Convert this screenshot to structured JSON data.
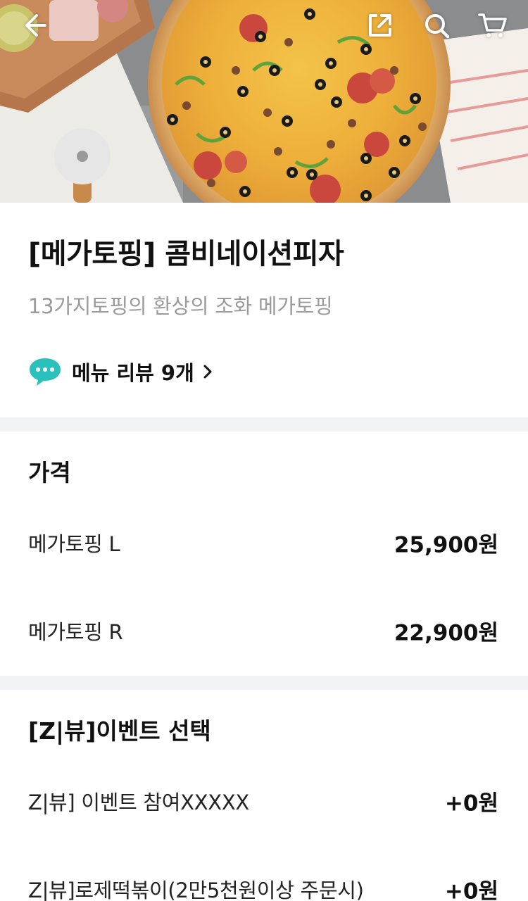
{
  "header": {
    "icons": {
      "back": "back-arrow-icon",
      "share": "share-icon",
      "search": "search-icon",
      "cart": "cart-icon"
    }
  },
  "product": {
    "title": "[메가토핑] 콤비네이션피자",
    "description": "13가지토핑의 환상의 조화 메가토핑",
    "review_link": "메뉴 리뷰 9개",
    "review_icon": "speech-bubble-icon",
    "review_icon_color": "#2ac1bc"
  },
  "price_section": {
    "title": "가격",
    "options": [
      {
        "label": "메가토핑 L",
        "price": "25,900원"
      },
      {
        "label": "메가토핑 R",
        "price": "22,900원"
      }
    ]
  },
  "event_section": {
    "title": "[Z|뷰]이벤트 선택",
    "options": [
      {
        "label": "Z|뷰] 이벤트 참여XXXXX",
        "price": "+0원"
      },
      {
        "label": "Z|뷰]로제떡볶이(2만5천원이상 주문시)",
        "price": "+0원"
      }
    ]
  },
  "colors": {
    "divider": "#f2f3f5",
    "description": "#9b9b9b",
    "accent": "#2ac1bc"
  }
}
